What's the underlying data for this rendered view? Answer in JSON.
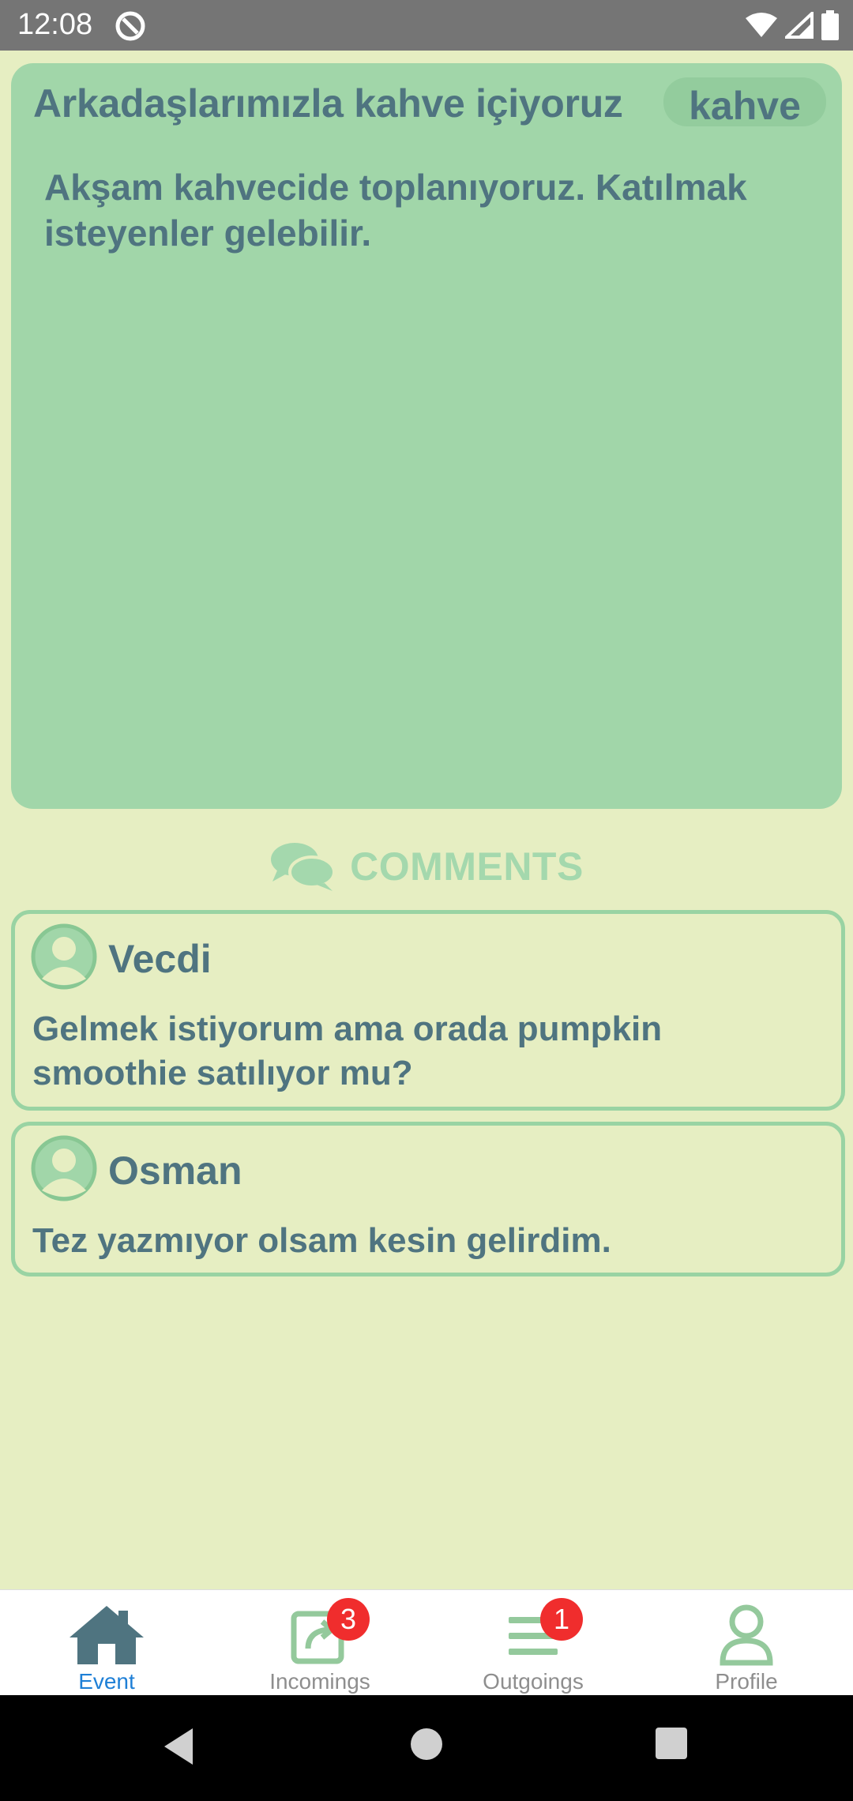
{
  "status_bar": {
    "time": "12:08"
  },
  "event": {
    "title": "Arkadaşlarımızla kahve içiyoruz",
    "tag": "kahve",
    "description": "Akşam kahvecide toplanıyoruz. Katılmak isteyenler gelebilir."
  },
  "comments_section": {
    "title": "COMMENTS",
    "items": [
      {
        "author": "Vecdi",
        "text": "Gelmek istiyorum ama orada pumpkin smoothie satılıyor mu?"
      },
      {
        "author": "Osman",
        "text": "Tez yazmıyor olsam kesin gelirdim."
      }
    ]
  },
  "bottom_nav": {
    "items": [
      {
        "label": "Event",
        "icon": "home-icon",
        "active": true
      },
      {
        "label": "Incomings",
        "icon": "incoming-icon",
        "badge": "3"
      },
      {
        "label": "Outgoings",
        "icon": "list-icon",
        "badge": "1"
      },
      {
        "label": "Profile",
        "icon": "person-icon"
      }
    ]
  },
  "colors": {
    "background": "#e6eec2",
    "card": "#a1d6a9",
    "text": "#4f7480",
    "accent_green": "#99d3a3",
    "active_nav": "#1e7fd6",
    "badge": "#f02d2d"
  }
}
